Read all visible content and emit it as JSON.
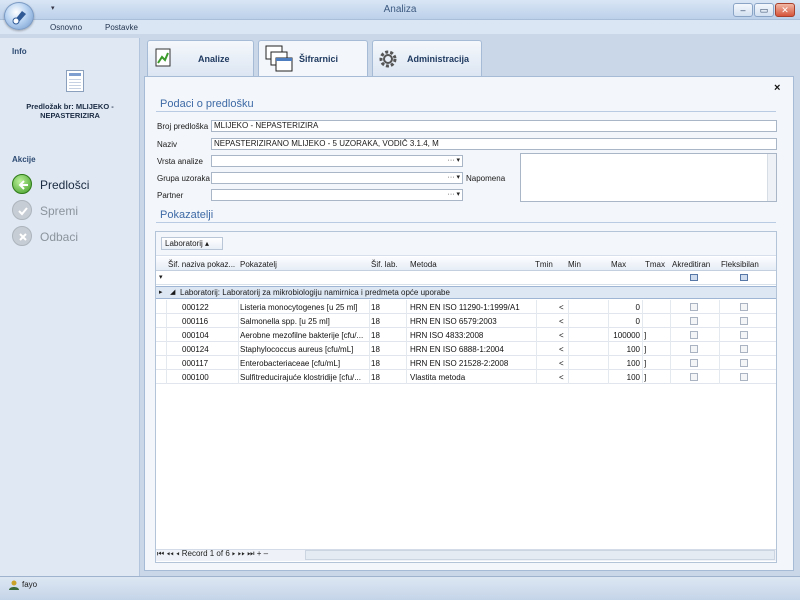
{
  "window": {
    "title": "Analiza",
    "qat_arrow": "▾",
    "buttons": {
      "minimize": "–",
      "restore": "▭",
      "close": "✕"
    }
  },
  "menu": {
    "items": [
      "Osnovno",
      "Postavke"
    ]
  },
  "left_panel": {
    "info_label": "Info",
    "template_info": "Predložak br: MLIJEKO - NEPASTERIZIRA",
    "actions_label": "Akcije",
    "actions": [
      {
        "label": "Predlošci",
        "icon": "back-arrow-icon",
        "enabled": true
      },
      {
        "label": "Spremi",
        "icon": "check-icon",
        "enabled": false
      },
      {
        "label": "Odbaci",
        "icon": "cancel-icon",
        "enabled": false
      }
    ]
  },
  "tabs": [
    {
      "label": "Analize",
      "icon": "analysis-icon",
      "active": false
    },
    {
      "label": "Šifrarnici",
      "icon": "windows-icon",
      "active": true
    },
    {
      "label": "Administracija",
      "icon": "gear-icon",
      "active": false
    }
  ],
  "form": {
    "section_title": "Podaci o predlošku",
    "close_label": "×",
    "fields": {
      "broj_label": "Broj predloška",
      "broj_value": "MLIJEKO - NEPASTERIZIRA",
      "naziv_label": "Naziv",
      "naziv_value": "NEPASTERIZIRANO MLIJEKO - 5 UZORAKA, VODIČ 3.1.4, M",
      "vrsta_label": "Vrsta analize",
      "grupa_label": "Grupa uzoraka",
      "partner_label": "Partner",
      "napomena_label": "Napomena",
      "dropdown_glyph": "··· ▾"
    }
  },
  "indicators": {
    "section_title": "Pokazatelji",
    "group_chip": "Laboratorij ▴",
    "columns": [
      "Šif. naziva pokaz...",
      "Pokazatelj",
      "Šif. lab.",
      "Metoda",
      "Tmin",
      "Min",
      "Max",
      "Tmax",
      "Akreditiran",
      "Fleksibilan"
    ],
    "filter_marker": "▾",
    "group_row": "Laboratorij: Laboratorij za mikrobiologiju namirnica i predmeta opće uporabe",
    "rows": [
      {
        "code": "000122",
        "name": "Listeria monocytogenes [u 25 ml]",
        "lab": "18",
        "method": "HRN EN ISO 11290-1:1999/A1",
        "tmin": "<",
        "max": "0",
        "tmax": ""
      },
      {
        "code": "000116",
        "name": "Salmonella spp. [u 25 ml]",
        "lab": "18",
        "method": "HRN EN ISO 6579:2003",
        "tmin": "<",
        "max": "0",
        "tmax": ""
      },
      {
        "code": "000104",
        "name": "Aerobne mezofilne bakterije [cfu/...",
        "lab": "18",
        "method": "HRN ISO 4833:2008",
        "tmin": "<",
        "max": "100000",
        "tmax": "]"
      },
      {
        "code": "000124",
        "name": "Staphylococcus aureus [cfu/mL]",
        "lab": "18",
        "method": "HRN EN ISO 6888-1:2004",
        "tmin": "<",
        "max": "100",
        "tmax": "]"
      },
      {
        "code": "000117",
        "name": "Enterobacteriaceae [cfu/mL]",
        "lab": "18",
        "method": "HRN EN ISO 21528-2:2008",
        "tmin": "<",
        "max": "100",
        "tmax": "]"
      },
      {
        "code": "000100",
        "name": "Sulfitreducirajuće klostridije [cfu/...",
        "lab": "18",
        "method": "Vlastita metoda",
        "tmin": "<",
        "max": "100",
        "tmax": "]"
      }
    ],
    "navigator": "⏮ ◂◂ ◂  Record 1 of 6  ▸ ▸▸ ⏭ + –"
  },
  "status": {
    "user": "fayo"
  }
}
